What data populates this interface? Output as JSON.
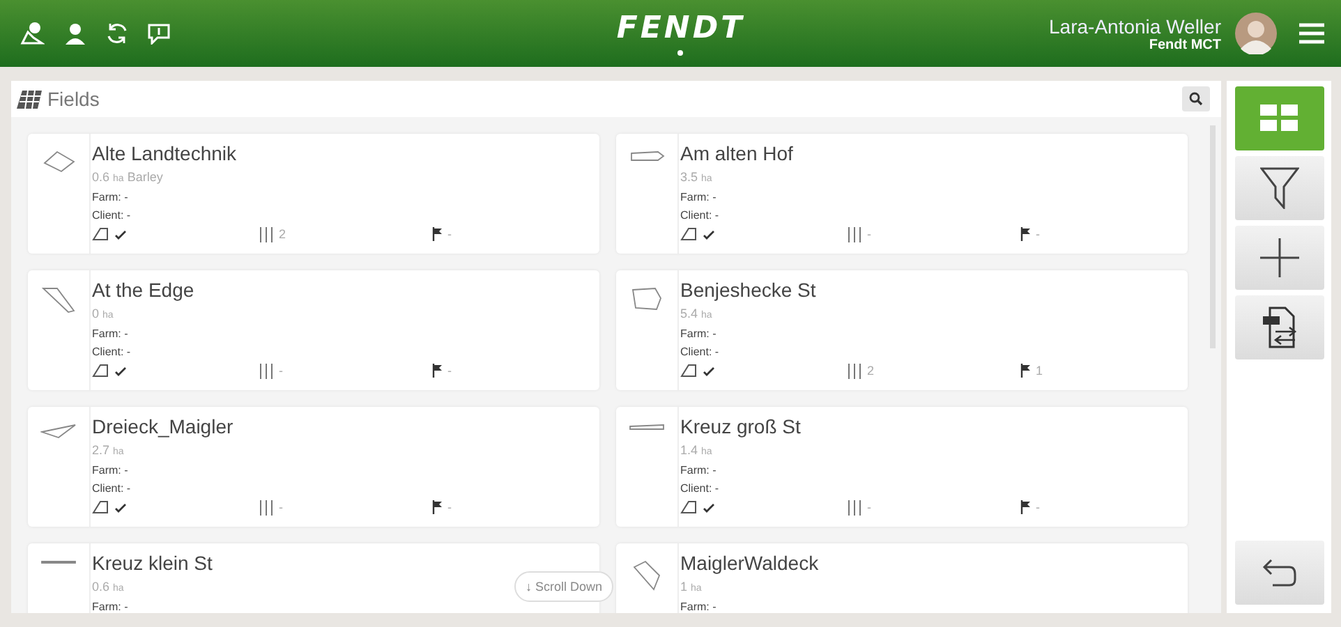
{
  "header": {
    "logo": "FENDT",
    "user_name": "Lara-Antonia Weller",
    "organization": "Fendt MCT"
  },
  "panel": {
    "title": "Fields"
  },
  "fields": [
    {
      "name": "Alte Landtechnik",
      "area": "0.6",
      "unit": "ha",
      "crop": "Barley",
      "farm_label": "Farm:",
      "farm": "-",
      "client_label": "Client:",
      "client": "-",
      "tracks": "2",
      "flags": "-"
    },
    {
      "name": "Am alten Hof",
      "area": "3.5",
      "unit": "ha",
      "farm_label": "Farm:",
      "farm": "-",
      "client_label": "Client:",
      "client": "-",
      "tracks": "-",
      "flags": "-"
    },
    {
      "name": "At the Edge",
      "area": "0",
      "unit": "ha",
      "farm_label": "Farm:",
      "farm": "-",
      "client_label": "Client:",
      "client": "-",
      "tracks": "-",
      "flags": "-"
    },
    {
      "name": "Benjeshecke St",
      "area": "5.4",
      "unit": "ha",
      "farm_label": "Farm:",
      "farm": "-",
      "client_label": "Client:",
      "client": "-",
      "tracks": "2",
      "flags": "1"
    },
    {
      "name": "Dreieck_Maigler",
      "area": "2.7",
      "unit": "ha",
      "farm_label": "Farm:",
      "farm": "-",
      "client_label": "Client:",
      "client": "-",
      "tracks": "-",
      "flags": "-"
    },
    {
      "name": "Kreuz groß St",
      "area": "1.4",
      "unit": "ha",
      "farm_label": "Farm:",
      "farm": "-",
      "client_label": "Client:",
      "client": "-",
      "tracks": "-",
      "flags": "-"
    },
    {
      "name": "Kreuz klein St",
      "area": "0.6",
      "unit": "ha",
      "farm_label": "Farm:",
      "farm": "-"
    },
    {
      "name": "MaiglerWaldeck",
      "area": "1",
      "unit": "ha",
      "farm_label": "Farm:",
      "farm": "-"
    }
  ],
  "scroll_hint": "↓ Scroll Down",
  "side_buttons": [
    {
      "kind": "grid",
      "selected": true
    },
    {
      "kind": "filter",
      "selected": false
    },
    {
      "kind": "add",
      "selected": false
    },
    {
      "kind": "import",
      "selected": false
    },
    {
      "kind": "back",
      "selected": false
    }
  ]
}
